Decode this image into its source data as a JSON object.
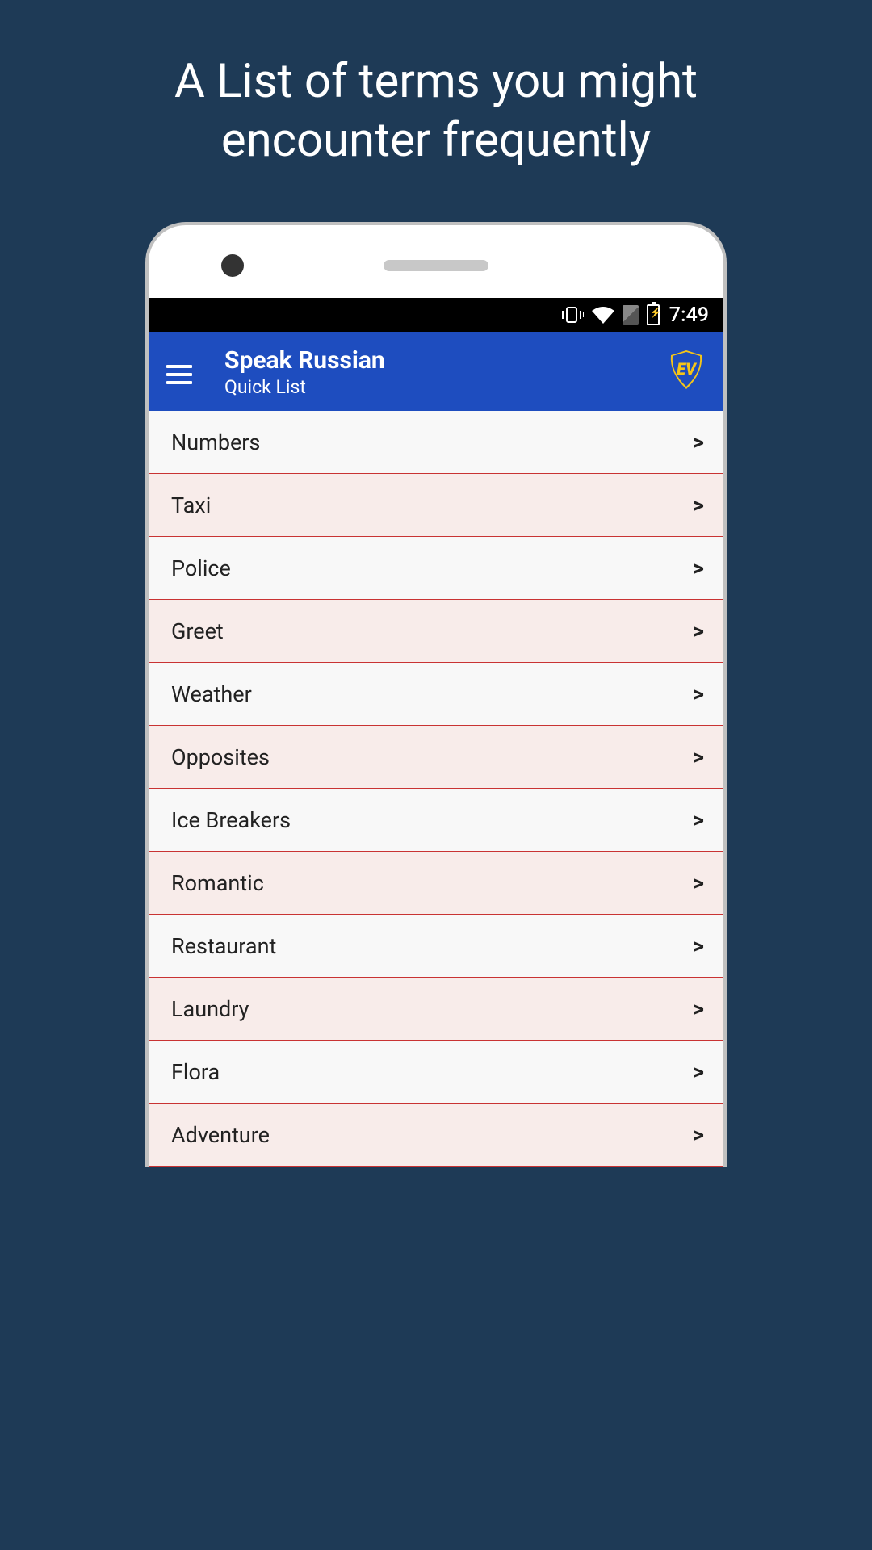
{
  "promo": {
    "text": "A List of terms you might encounter frequently"
  },
  "statusBar": {
    "time": "7:49"
  },
  "header": {
    "title": "Speak Russian",
    "subtitle": "Quick List"
  },
  "list": {
    "items": [
      {
        "label": "Numbers"
      },
      {
        "label": "Taxi"
      },
      {
        "label": "Police"
      },
      {
        "label": "Greet"
      },
      {
        "label": "Weather"
      },
      {
        "label": "Opposites"
      },
      {
        "label": "Ice Breakers"
      },
      {
        "label": "Romantic"
      },
      {
        "label": "Restaurant"
      },
      {
        "label": "Laundry"
      },
      {
        "label": "Flora"
      },
      {
        "label": "Adventure"
      }
    ]
  }
}
